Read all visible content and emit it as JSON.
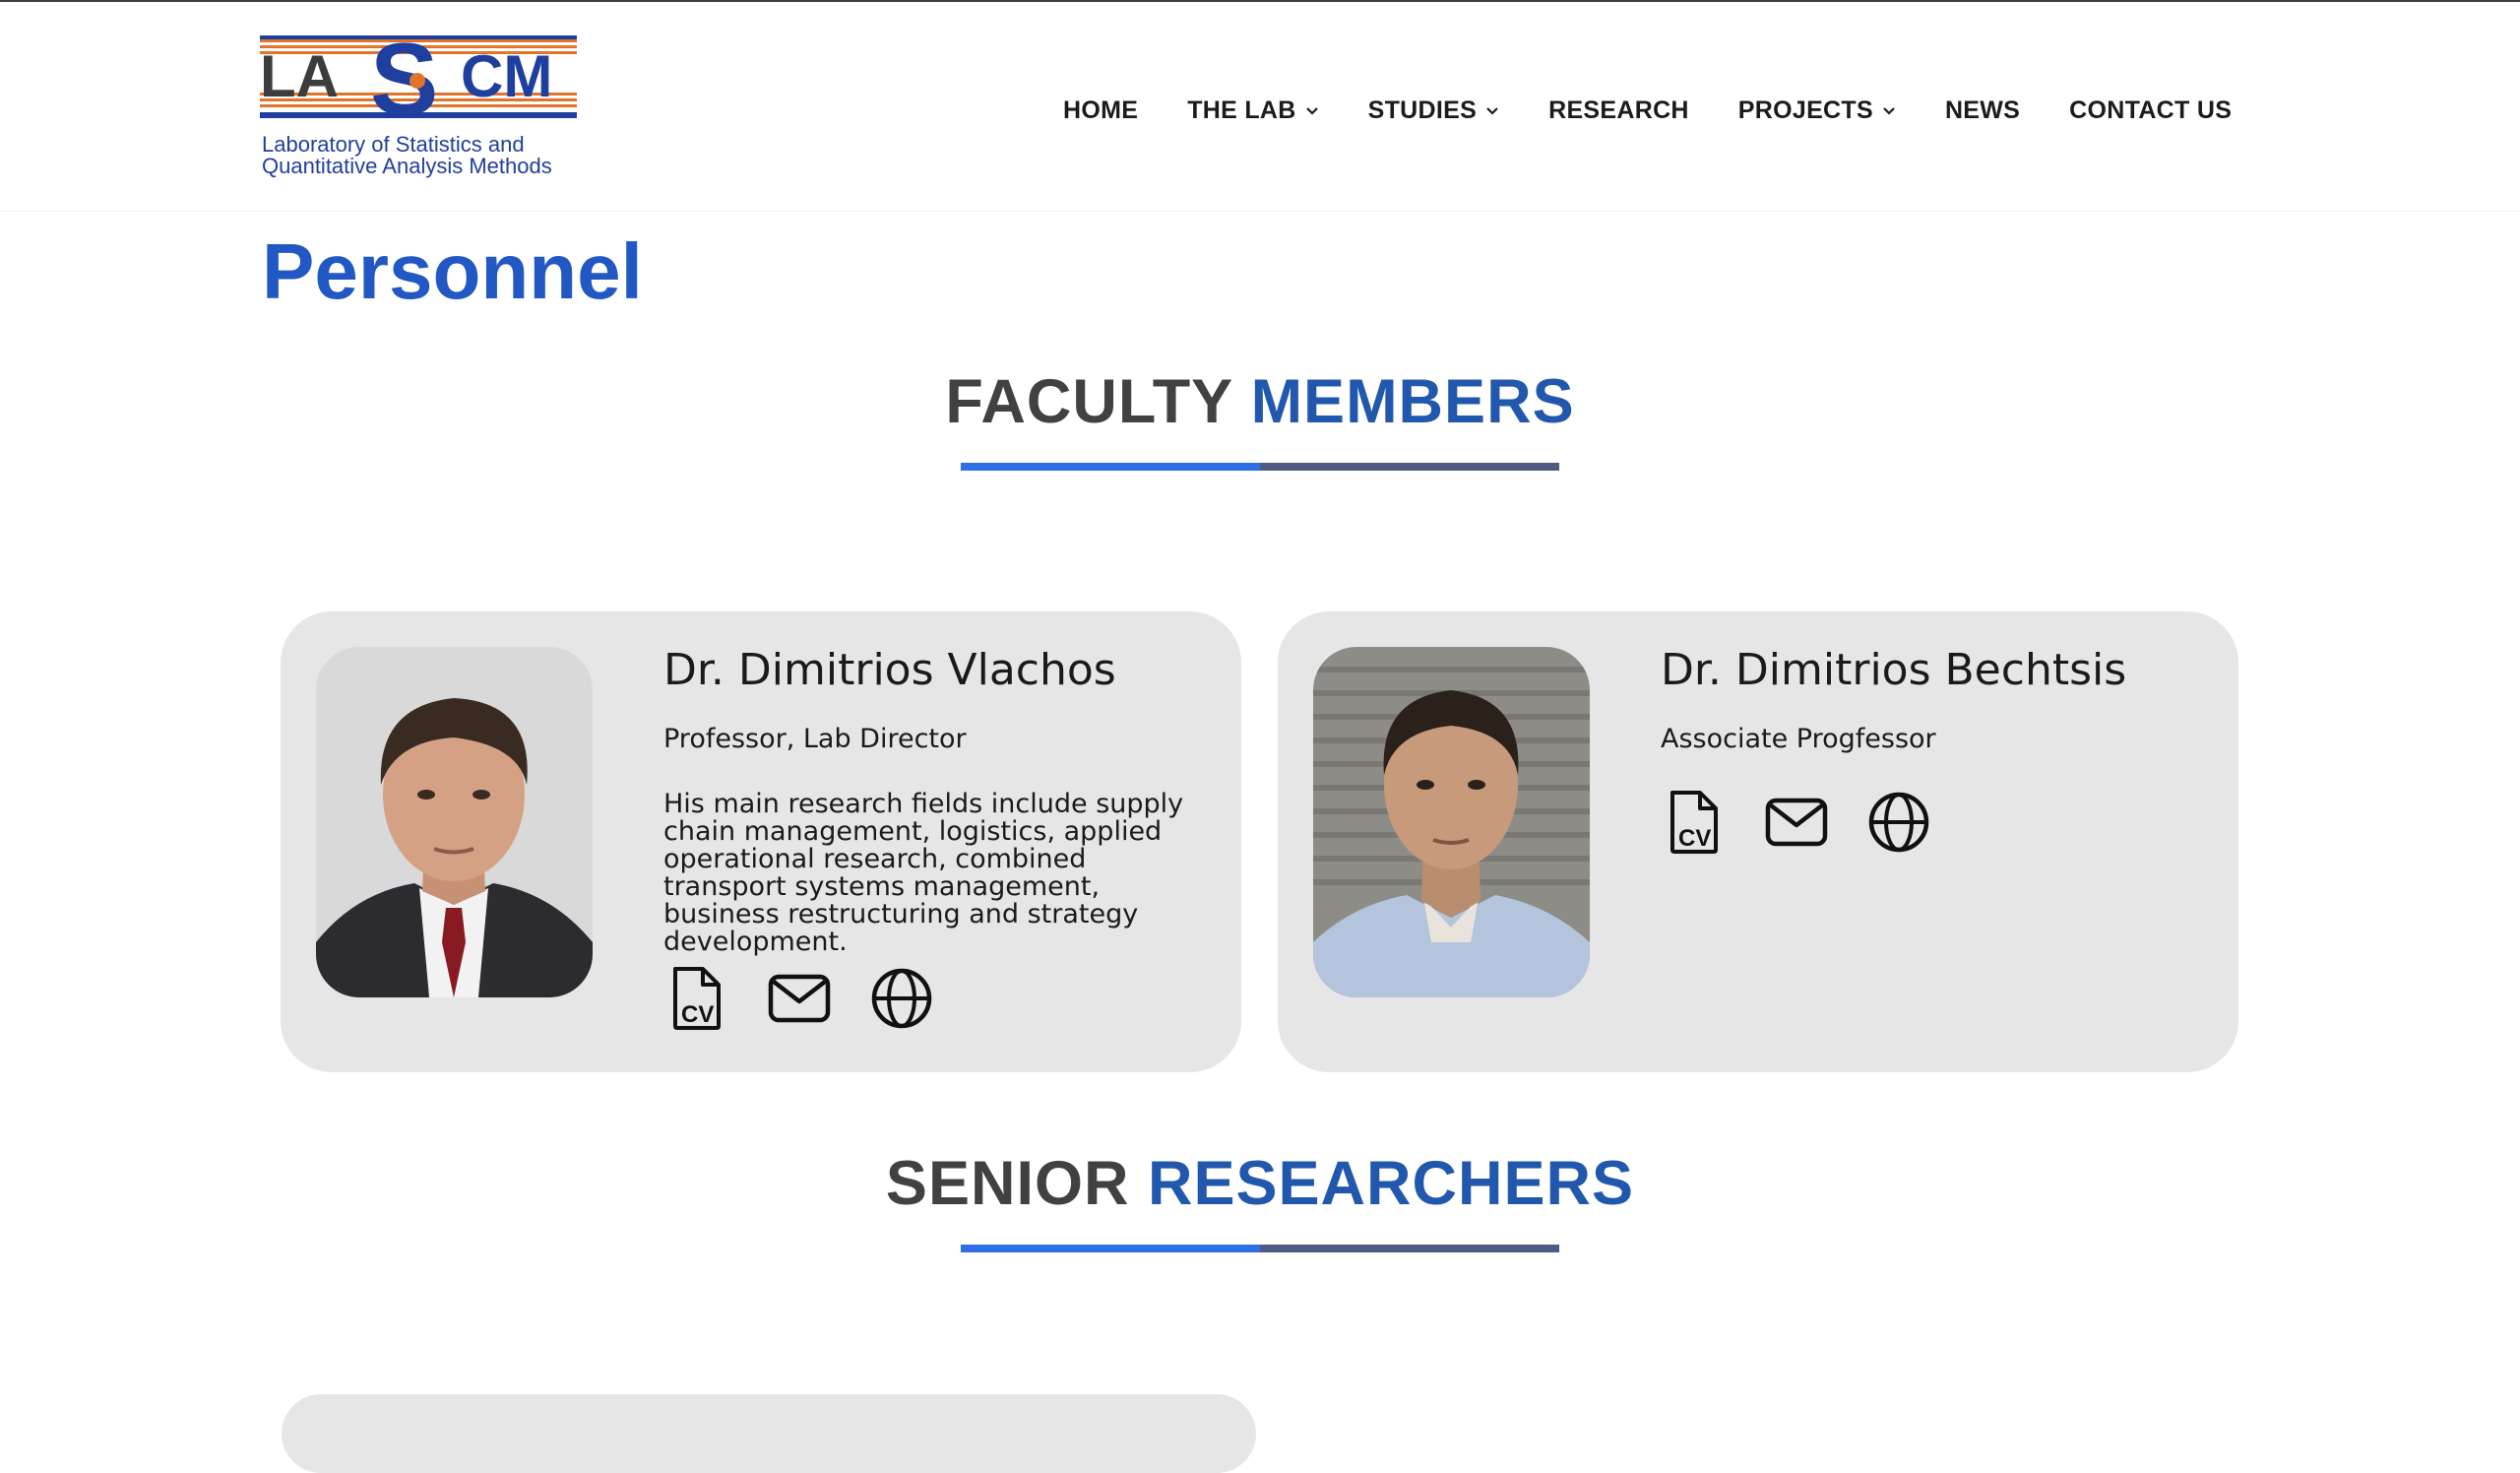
{
  "logo": {
    "letters": "LASCM",
    "subtitle_line1": "Laboratory of Statistics and",
    "subtitle_line2": "Quantitative Analysis Methods"
  },
  "nav": [
    {
      "label": "HOME",
      "dropdown": false
    },
    {
      "label": "THE LAB",
      "dropdown": true
    },
    {
      "label": "STUDIES",
      "dropdown": true
    },
    {
      "label": "RESEARCH",
      "dropdown": false
    },
    {
      "label": "PROJECTS",
      "dropdown": true
    },
    {
      "label": "NEWS",
      "dropdown": false
    },
    {
      "label": "CONTACT US",
      "dropdown": false
    }
  ],
  "page_title": "Personnel",
  "sections": {
    "faculty": {
      "part1": "FACULTY",
      "part2": "MEMBERS"
    },
    "senior": {
      "part1": "SENIOR",
      "part2": "RESEARCHERS"
    }
  },
  "faculty_members": [
    {
      "name": "Dr. Dimitrios Vlachos",
      "role": "Professor, Lab Director",
      "description": "His main research fields include supply chain management, logistics, applied operational research, combined transport systems management, business restructuring and strategy development.",
      "icons": [
        "cv-file-icon",
        "mail-icon",
        "globe-icon"
      ]
    },
    {
      "name": "Dr. Dimitrios Bechtsis",
      "role": "Associate Progfessor",
      "description": "",
      "icons": [
        "cv-file-icon",
        "mail-icon",
        "globe-icon"
      ]
    }
  ],
  "colors": {
    "title_blue": "#2158c4",
    "heading_gray": "#414141",
    "heading_blue": "#2158ad",
    "card_bg": "#e6e6e6",
    "logo_blue": "#1f3f9f",
    "logo_orange": "#e0742a"
  }
}
